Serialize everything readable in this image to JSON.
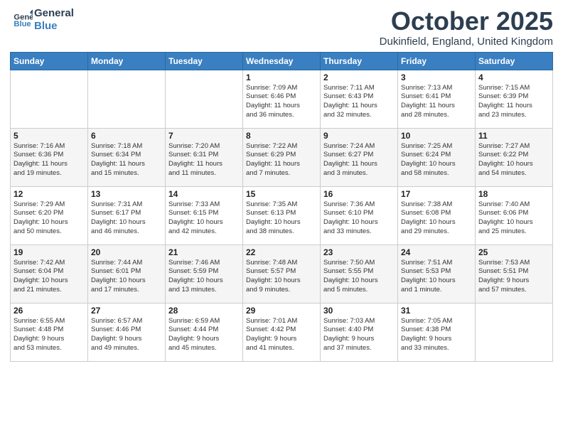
{
  "logo": {
    "line1": "General",
    "line2": "Blue"
  },
  "header": {
    "month": "October 2025",
    "location": "Dukinfield, England, United Kingdom"
  },
  "weekdays": [
    "Sunday",
    "Monday",
    "Tuesday",
    "Wednesday",
    "Thursday",
    "Friday",
    "Saturday"
  ],
  "weeks": [
    [
      {
        "day": "",
        "info": ""
      },
      {
        "day": "",
        "info": ""
      },
      {
        "day": "",
        "info": ""
      },
      {
        "day": "1",
        "info": "Sunrise: 7:09 AM\nSunset: 6:46 PM\nDaylight: 11 hours\nand 36 minutes."
      },
      {
        "day": "2",
        "info": "Sunrise: 7:11 AM\nSunset: 6:43 PM\nDaylight: 11 hours\nand 32 minutes."
      },
      {
        "day": "3",
        "info": "Sunrise: 7:13 AM\nSunset: 6:41 PM\nDaylight: 11 hours\nand 28 minutes."
      },
      {
        "day": "4",
        "info": "Sunrise: 7:15 AM\nSunset: 6:39 PM\nDaylight: 11 hours\nand 23 minutes."
      }
    ],
    [
      {
        "day": "5",
        "info": "Sunrise: 7:16 AM\nSunset: 6:36 PM\nDaylight: 11 hours\nand 19 minutes."
      },
      {
        "day": "6",
        "info": "Sunrise: 7:18 AM\nSunset: 6:34 PM\nDaylight: 11 hours\nand 15 minutes."
      },
      {
        "day": "7",
        "info": "Sunrise: 7:20 AM\nSunset: 6:31 PM\nDaylight: 11 hours\nand 11 minutes."
      },
      {
        "day": "8",
        "info": "Sunrise: 7:22 AM\nSunset: 6:29 PM\nDaylight: 11 hours\nand 7 minutes."
      },
      {
        "day": "9",
        "info": "Sunrise: 7:24 AM\nSunset: 6:27 PM\nDaylight: 11 hours\nand 3 minutes."
      },
      {
        "day": "10",
        "info": "Sunrise: 7:25 AM\nSunset: 6:24 PM\nDaylight: 10 hours\nand 58 minutes."
      },
      {
        "day": "11",
        "info": "Sunrise: 7:27 AM\nSunset: 6:22 PM\nDaylight: 10 hours\nand 54 minutes."
      }
    ],
    [
      {
        "day": "12",
        "info": "Sunrise: 7:29 AM\nSunset: 6:20 PM\nDaylight: 10 hours\nand 50 minutes."
      },
      {
        "day": "13",
        "info": "Sunrise: 7:31 AM\nSunset: 6:17 PM\nDaylight: 10 hours\nand 46 minutes."
      },
      {
        "day": "14",
        "info": "Sunrise: 7:33 AM\nSunset: 6:15 PM\nDaylight: 10 hours\nand 42 minutes."
      },
      {
        "day": "15",
        "info": "Sunrise: 7:35 AM\nSunset: 6:13 PM\nDaylight: 10 hours\nand 38 minutes."
      },
      {
        "day": "16",
        "info": "Sunrise: 7:36 AM\nSunset: 6:10 PM\nDaylight: 10 hours\nand 33 minutes."
      },
      {
        "day": "17",
        "info": "Sunrise: 7:38 AM\nSunset: 6:08 PM\nDaylight: 10 hours\nand 29 minutes."
      },
      {
        "day": "18",
        "info": "Sunrise: 7:40 AM\nSunset: 6:06 PM\nDaylight: 10 hours\nand 25 minutes."
      }
    ],
    [
      {
        "day": "19",
        "info": "Sunrise: 7:42 AM\nSunset: 6:04 PM\nDaylight: 10 hours\nand 21 minutes."
      },
      {
        "day": "20",
        "info": "Sunrise: 7:44 AM\nSunset: 6:01 PM\nDaylight: 10 hours\nand 17 minutes."
      },
      {
        "day": "21",
        "info": "Sunrise: 7:46 AM\nSunset: 5:59 PM\nDaylight: 10 hours\nand 13 minutes."
      },
      {
        "day": "22",
        "info": "Sunrise: 7:48 AM\nSunset: 5:57 PM\nDaylight: 10 hours\nand 9 minutes."
      },
      {
        "day": "23",
        "info": "Sunrise: 7:50 AM\nSunset: 5:55 PM\nDaylight: 10 hours\nand 5 minutes."
      },
      {
        "day": "24",
        "info": "Sunrise: 7:51 AM\nSunset: 5:53 PM\nDaylight: 10 hours\nand 1 minute."
      },
      {
        "day": "25",
        "info": "Sunrise: 7:53 AM\nSunset: 5:51 PM\nDaylight: 9 hours\nand 57 minutes."
      }
    ],
    [
      {
        "day": "26",
        "info": "Sunrise: 6:55 AM\nSunset: 4:48 PM\nDaylight: 9 hours\nand 53 minutes."
      },
      {
        "day": "27",
        "info": "Sunrise: 6:57 AM\nSunset: 4:46 PM\nDaylight: 9 hours\nand 49 minutes."
      },
      {
        "day": "28",
        "info": "Sunrise: 6:59 AM\nSunset: 4:44 PM\nDaylight: 9 hours\nand 45 minutes."
      },
      {
        "day": "29",
        "info": "Sunrise: 7:01 AM\nSunset: 4:42 PM\nDaylight: 9 hours\nand 41 minutes."
      },
      {
        "day": "30",
        "info": "Sunrise: 7:03 AM\nSunset: 4:40 PM\nDaylight: 9 hours\nand 37 minutes."
      },
      {
        "day": "31",
        "info": "Sunrise: 7:05 AM\nSunset: 4:38 PM\nDaylight: 9 hours\nand 33 minutes."
      },
      {
        "day": "",
        "info": ""
      }
    ]
  ]
}
